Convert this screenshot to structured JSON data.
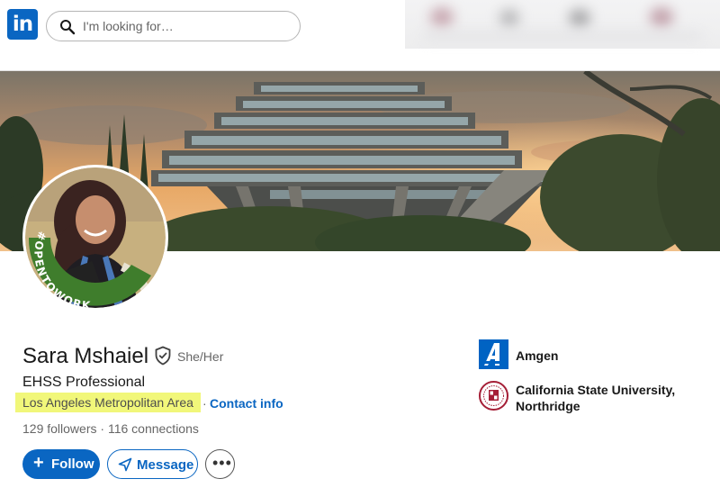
{
  "nav": {
    "logo_text": "in",
    "search_placeholder": "I'm looking for…",
    "search_icon": "search-icon"
  },
  "profile": {
    "name": "Sara Mshaiel",
    "pronouns": "She/Her",
    "headline": "EHSS Professional",
    "location": "Los Angeles Metropolitan Area",
    "separator": "·",
    "contact_label": "Contact info",
    "followers": "129 followers",
    "connections": "116 connections",
    "stats_separator": " · ",
    "open_to_work_frame": "#OPENTOWORK",
    "verify_icon": "shield-check-icon"
  },
  "actions": {
    "follow_label": "Follow",
    "message_label": "Message",
    "more_icon": "more-horizontal-icon"
  },
  "sidebar": {
    "company": "Amgen",
    "school": "California State University, Northridge"
  },
  "colors": {
    "brand": "#0a66c2",
    "open_to_work_green": "#3f7d2c",
    "location_highlight": "#f1f77a"
  }
}
